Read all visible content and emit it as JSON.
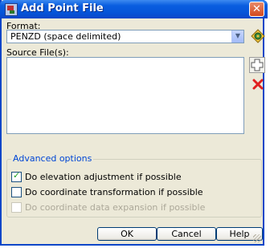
{
  "window": {
    "title": "Add Point File",
    "close_icon": "close-icon"
  },
  "format": {
    "label": "Format:",
    "selected": "PENZD (space delimited)"
  },
  "source": {
    "label": "Source File(s):",
    "files": []
  },
  "advanced": {
    "title": "Advanced options",
    "options": [
      {
        "label": "Do elevation adjustment if possible",
        "checked": true,
        "enabled": true
      },
      {
        "label": "Do coordinate transformation if possible",
        "checked": false,
        "enabled": true
      },
      {
        "label": "Do coordinate data expansion if possible",
        "checked": false,
        "enabled": false
      }
    ]
  },
  "buttons": {
    "ok": "OK",
    "cancel": "Cancel",
    "help": "Help"
  },
  "colors": {
    "titlebar": "#0554d8",
    "dialog_bg": "#ece9d8",
    "group_title": "#0046d5",
    "remove_icon": "#e02020"
  }
}
